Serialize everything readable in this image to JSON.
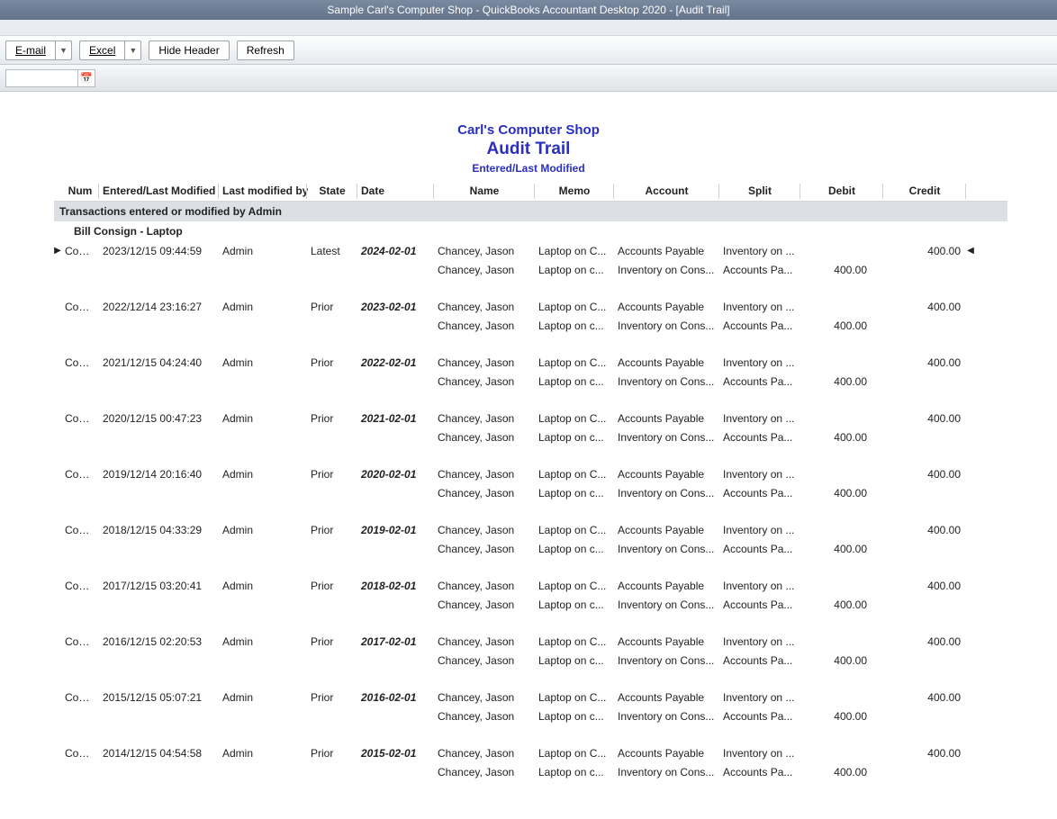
{
  "titlebar": "Sample Carl's Computer Shop  - QuickBooks Accountant Desktop 2020 - [Audit Trail]",
  "toolbar": {
    "email": "E-mail",
    "excel": "Excel",
    "hide_header": "Hide Header",
    "refresh": "Refresh"
  },
  "report": {
    "company": "Carl's Computer Shop",
    "title": "Audit Trail",
    "subtitle": "Entered/Last Modified"
  },
  "columns": {
    "num": "Num",
    "modified": "Entered/Last Modified",
    "user": "Last modified by",
    "state": "State",
    "date": "Date",
    "name": "Name",
    "memo": "Memo",
    "account": "Account",
    "split": "Split",
    "debit": "Debit",
    "credit": "Credit"
  },
  "group_band": "Transactions entered or modified by Admin",
  "group_label": "Bill Consign - Laptop",
  "blocks": [
    {
      "marker": "▶",
      "num": "Cons...",
      "modified": "2023/12/15 09:44:59",
      "user": "Admin",
      "state": "Latest",
      "date": "2024-02-01",
      "l1_name": "Chancey, Jason",
      "l1_memo": "Laptop on C...",
      "l1_acct": "Accounts Payable",
      "l1_split": "Inventory on ...",
      "l1_credit": "400.00",
      "end": "◀",
      "l2_name": "Chancey, Jason",
      "l2_memo": "Laptop on c...",
      "l2_acct": "Inventory on Cons...",
      "l2_split": "Accounts Pa...",
      "l2_debit": "400.00"
    },
    {
      "num": "Cons...",
      "modified": "2022/12/14 23:16:27",
      "user": "Admin",
      "state": "Prior",
      "date": "2023-02-01",
      "l1_name": "Chancey, Jason",
      "l1_memo": "Laptop on C...",
      "l1_acct": "Accounts Payable",
      "l1_split": "Inventory on ...",
      "l1_credit": "400.00",
      "l2_name": "Chancey, Jason",
      "l2_memo": "Laptop on c...",
      "l2_acct": "Inventory on Cons...",
      "l2_split": "Accounts Pa...",
      "l2_debit": "400.00"
    },
    {
      "num": "Cons...",
      "modified": "2021/12/15 04:24:40",
      "user": "Admin",
      "state": "Prior",
      "date": "2022-02-01",
      "l1_name": "Chancey, Jason",
      "l1_memo": "Laptop on C...",
      "l1_acct": "Accounts Payable",
      "l1_split": "Inventory on ...",
      "l1_credit": "400.00",
      "l2_name": "Chancey, Jason",
      "l2_memo": "Laptop on c...",
      "l2_acct": "Inventory on Cons...",
      "l2_split": "Accounts Pa...",
      "l2_debit": "400.00"
    },
    {
      "num": "Cons...",
      "modified": "2020/12/15 00:47:23",
      "user": "Admin",
      "state": "Prior",
      "date": "2021-02-01",
      "l1_name": "Chancey, Jason",
      "l1_memo": "Laptop on C...",
      "l1_acct": "Accounts Payable",
      "l1_split": "Inventory on ...",
      "l1_credit": "400.00",
      "l2_name": "Chancey, Jason",
      "l2_memo": "Laptop on c...",
      "l2_acct": "Inventory on Cons...",
      "l2_split": "Accounts Pa...",
      "l2_debit": "400.00"
    },
    {
      "num": "Cons...",
      "modified": "2019/12/14 20:16:40",
      "user": "Admin",
      "state": "Prior",
      "date": "2020-02-01",
      "l1_name": "Chancey, Jason",
      "l1_memo": "Laptop on C...",
      "l1_acct": "Accounts Payable",
      "l1_split": "Inventory on ...",
      "l1_credit": "400.00",
      "l2_name": "Chancey, Jason",
      "l2_memo": "Laptop on c...",
      "l2_acct": "Inventory on Cons...",
      "l2_split": "Accounts Pa...",
      "l2_debit": "400.00"
    },
    {
      "num": "Cons...",
      "modified": "2018/12/15 04:33:29",
      "user": "Admin",
      "state": "Prior",
      "date": "2019-02-01",
      "l1_name": "Chancey, Jason",
      "l1_memo": "Laptop on C...",
      "l1_acct": "Accounts Payable",
      "l1_split": "Inventory on ...",
      "l1_credit": "400.00",
      "l2_name": "Chancey, Jason",
      "l2_memo": "Laptop on c...",
      "l2_acct": "Inventory on Cons...",
      "l2_split": "Accounts Pa...",
      "l2_debit": "400.00"
    },
    {
      "num": "Cons...",
      "modified": "2017/12/15 03:20:41",
      "user": "Admin",
      "state": "Prior",
      "date": "2018-02-01",
      "l1_name": "Chancey, Jason",
      "l1_memo": "Laptop on C...",
      "l1_acct": "Accounts Payable",
      "l1_split": "Inventory on ...",
      "l1_credit": "400.00",
      "l2_name": "Chancey, Jason",
      "l2_memo": "Laptop on c...",
      "l2_acct": "Inventory on Cons...",
      "l2_split": "Accounts Pa...",
      "l2_debit": "400.00"
    },
    {
      "num": "Cons...",
      "modified": "2016/12/15 02:20:53",
      "user": "Admin",
      "state": "Prior",
      "date": "2017-02-01",
      "l1_name": "Chancey, Jason",
      "l1_memo": "Laptop on C...",
      "l1_acct": "Accounts Payable",
      "l1_split": "Inventory on ...",
      "l1_credit": "400.00",
      "l2_name": "Chancey, Jason",
      "l2_memo": "Laptop on c...",
      "l2_acct": "Inventory on Cons...",
      "l2_split": "Accounts Pa...",
      "l2_debit": "400.00"
    },
    {
      "num": "Cons...",
      "modified": "2015/12/15 05:07:21",
      "user": "Admin",
      "state": "Prior",
      "date": "2016-02-01",
      "l1_name": "Chancey, Jason",
      "l1_memo": "Laptop on C...",
      "l1_acct": "Accounts Payable",
      "l1_split": "Inventory on ...",
      "l1_credit": "400.00",
      "l2_name": "Chancey, Jason",
      "l2_memo": "Laptop on c...",
      "l2_acct": "Inventory on Cons...",
      "l2_split": "Accounts Pa...",
      "l2_debit": "400.00"
    },
    {
      "num": "Cons...",
      "modified": "2014/12/15 04:54:58",
      "user": "Admin",
      "state": "Prior",
      "date": "2015-02-01",
      "l1_name": "Chancey, Jason",
      "l1_memo": "Laptop on C...",
      "l1_acct": "Accounts Payable",
      "l1_split": "Inventory on ...",
      "l1_credit": "400.00",
      "l2_name": "Chancey, Jason",
      "l2_memo": "Laptop on c...",
      "l2_acct": "Inventory on Cons...",
      "l2_split": "Accounts Pa...",
      "l2_debit": "400.00"
    }
  ]
}
